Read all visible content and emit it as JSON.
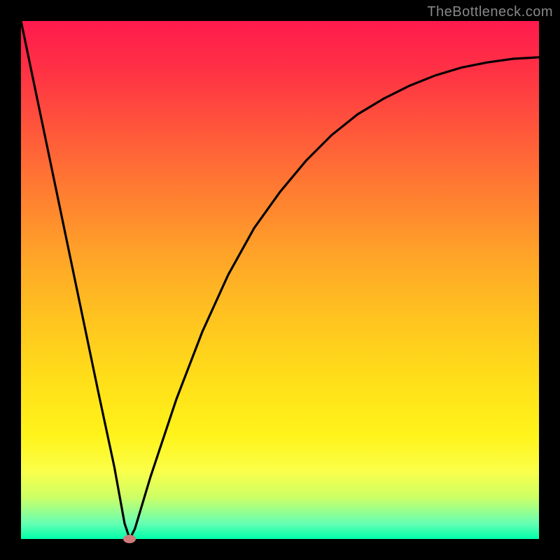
{
  "watermark": "TheBottleneck.com",
  "chart_data": {
    "type": "line",
    "title": "",
    "xlabel": "",
    "ylabel": "",
    "xlim": [
      0,
      100
    ],
    "ylim": [
      0,
      100
    ],
    "x": [
      0,
      5,
      10,
      15,
      18,
      20,
      21,
      22,
      25,
      30,
      35,
      40,
      45,
      50,
      55,
      60,
      65,
      70,
      75,
      80,
      85,
      90,
      95,
      100
    ],
    "values": [
      100,
      76,
      52,
      28,
      14,
      3,
      0,
      2,
      12,
      27,
      40,
      51,
      60,
      67,
      73,
      78,
      82,
      85,
      87.5,
      89.5,
      91,
      92,
      92.7,
      93
    ],
    "minimum_marker": {
      "x": 21,
      "y": 0
    },
    "annotations": []
  },
  "colors": {
    "curve": "#000000",
    "background_border": "#000000",
    "marker": "#d07a7a"
  }
}
